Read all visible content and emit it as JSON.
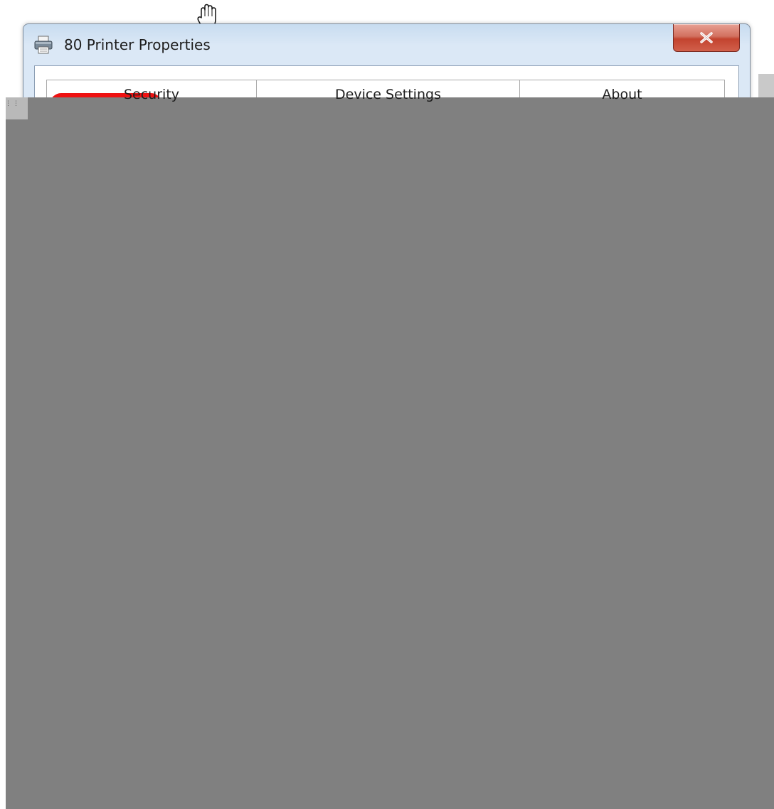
{
  "window": {
    "title": "80 Printer Properties",
    "printer_icon": "printer-icon",
    "close_icon": "close-icon",
    "close_color": "#c3432f"
  },
  "tabs": [
    {
      "label": "Security"
    },
    {
      "label": "Device Settings"
    },
    {
      "label": "About"
    }
  ],
  "colors": {
    "overlay": "#808080",
    "highlight": "#ee1111"
  },
  "cursor_icon": "hand-cursor-icon"
}
